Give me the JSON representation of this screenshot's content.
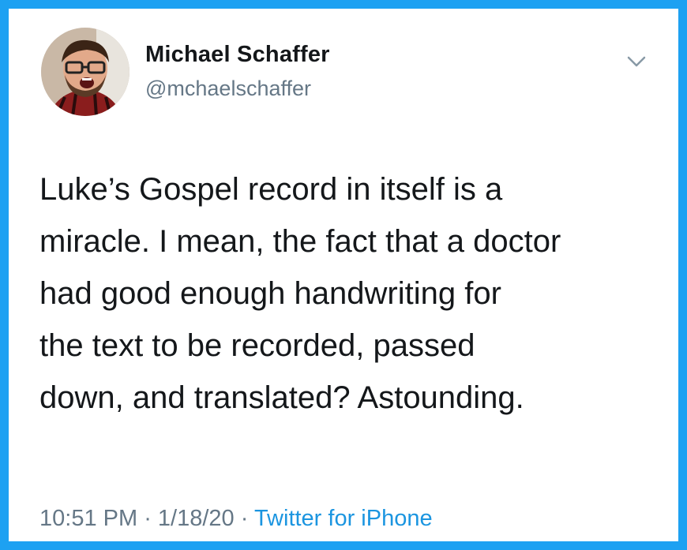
{
  "tweet": {
    "author_name": "Michael Schaffer",
    "author_handle": "@mchaelschaffer",
    "text": "Luke’s Gospel record in itself is a\nmiracle. I mean, the fact that a doctor\nhad good enough handwriting for\nthe text to be recorded, passed\ndown, and translated? Astounding.",
    "time": "10:51 PM",
    "separator": " · ",
    "date": "1/18/20",
    "source": "Twitter for iPhone"
  },
  "icons": {
    "avatar": "user-avatar-photo",
    "menu": "chevron-down-icon"
  },
  "colors": {
    "frame": "#1da1f2",
    "text": "#14171a",
    "secondary": "#657786",
    "link": "#1b95e0",
    "background": "#ffffff"
  }
}
